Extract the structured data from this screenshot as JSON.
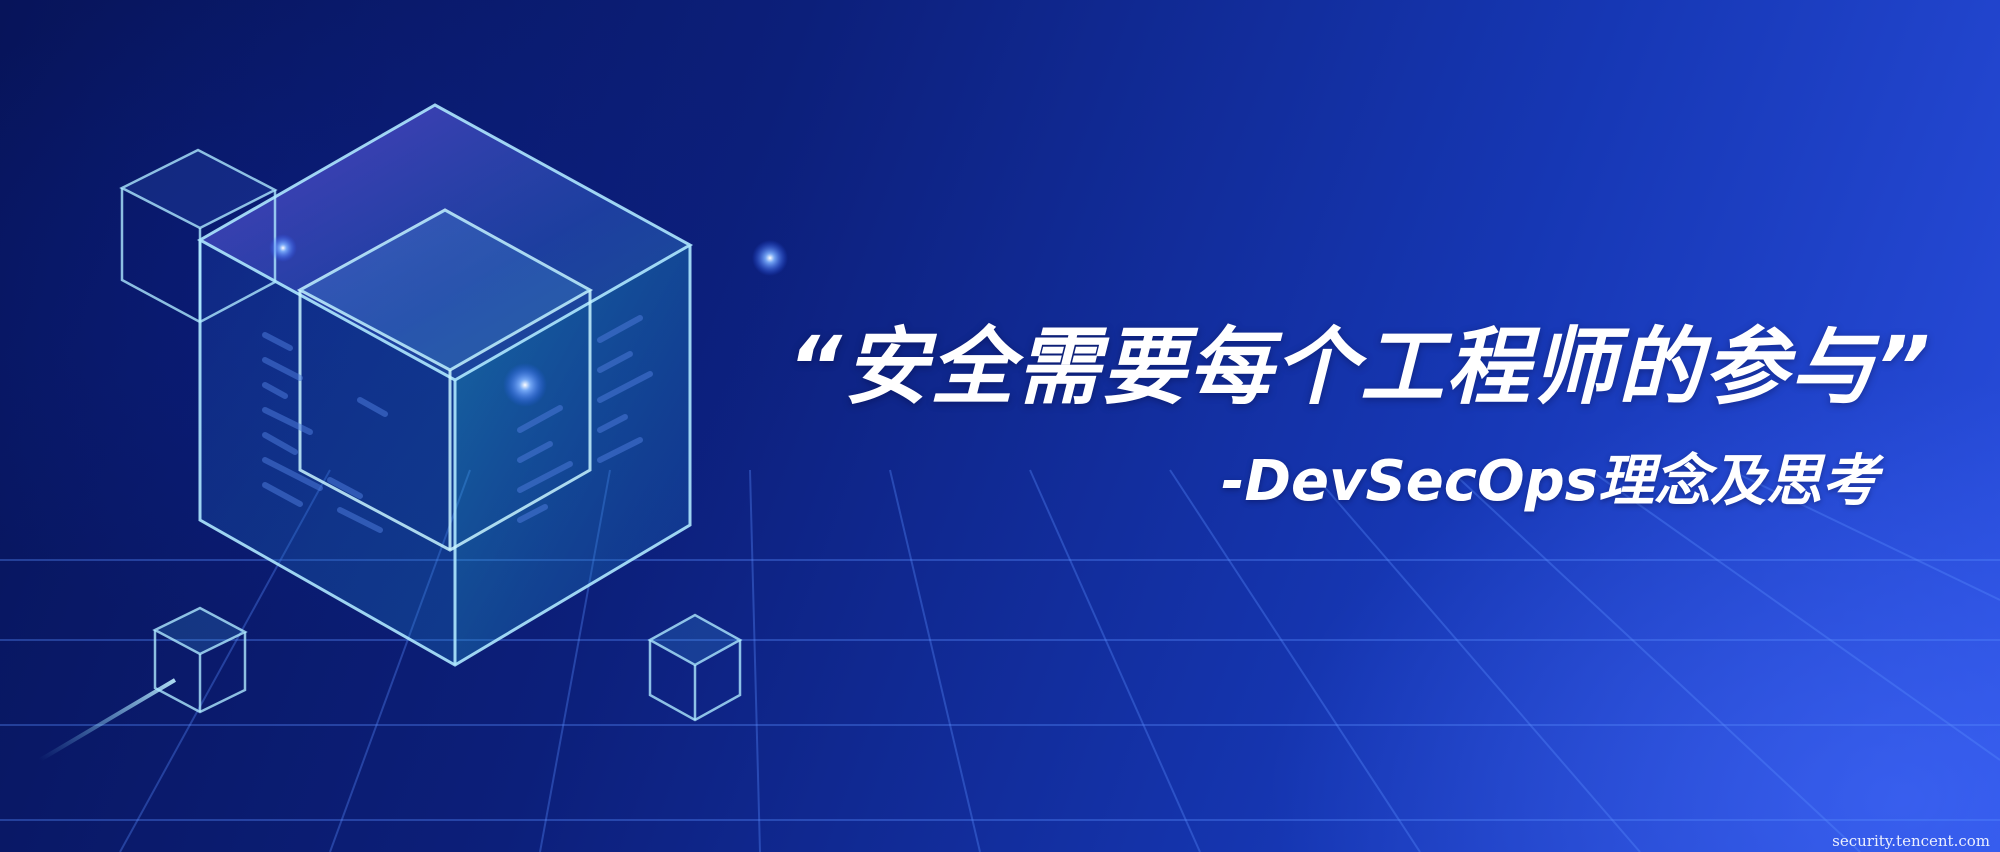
{
  "banner": {
    "headline": "“安全需要每个工程师的参与”",
    "subtitle": "-DevSecOps理念及思考",
    "watermark": "security.tencent.com"
  },
  "decoration": {
    "background_color": "#0c1f7a",
    "accent_color": "#2a4fe0",
    "glow_color": "#4f8bff",
    "cube_edge_color": "#aee8ff",
    "icon_names": [
      "glass-cube-large",
      "glass-cube-small",
      "glow-spark",
      "perspective-grid"
    ]
  }
}
